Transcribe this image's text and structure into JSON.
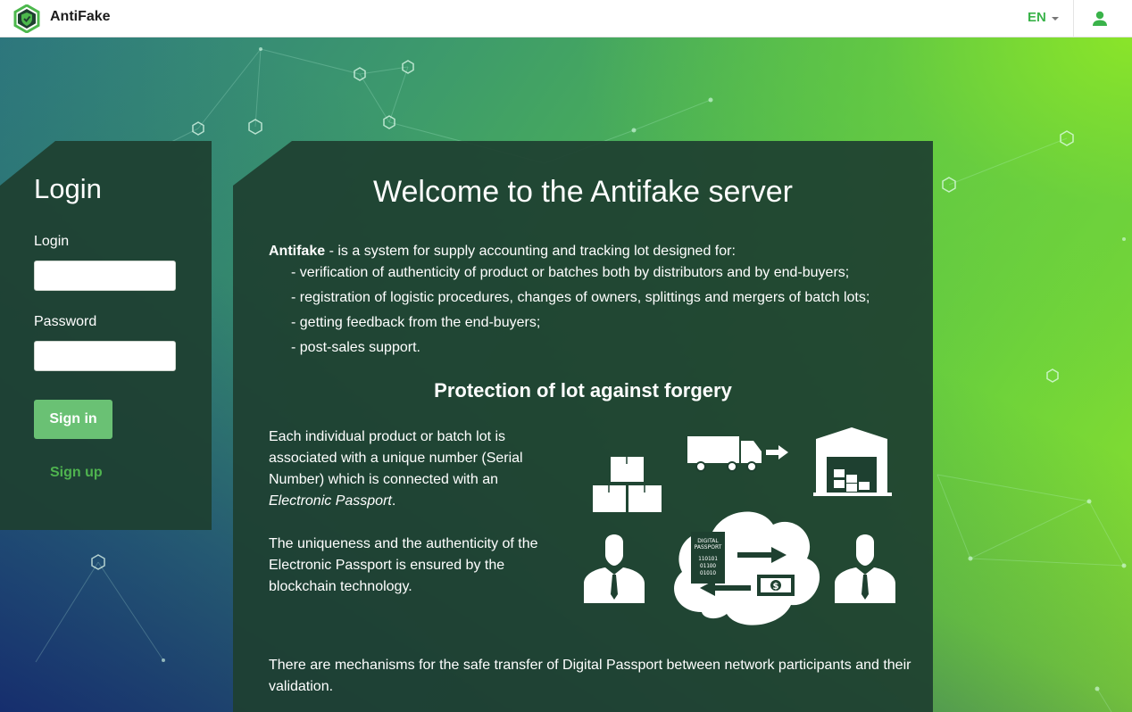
{
  "header": {
    "brand": "AntiFake",
    "language": "EN"
  },
  "login": {
    "title": "Login",
    "login_label": "Login",
    "login_value": "",
    "password_label": "Password",
    "password_value": "",
    "signin_label": "Sign in",
    "signup_label": "Sign up"
  },
  "main": {
    "title": "Welcome to the Antifake server",
    "intro_brand": "Antifake",
    "intro_text": " - is a system for supply accounting and tracking lot designed for:",
    "bullets": [
      "- verification of authenticity of product or batches both by distributors and by end-buyers;",
      "- registration of logistic procedures, changes of owners, splittings and mergers of batch lots;",
      "- getting feedback from the end-buyers;",
      "- post-sales support."
    ],
    "subtitle": "Protection of lot against forgery",
    "para1_text": "Each individual product or batch lot is associated with a unique number (Serial Number) which is connected with an ",
    "para1_italic": "Electronic Passport",
    "para1_end": ".",
    "para2": "The uniqueness and the authenticity of the Electronic Passport is ensured by the blockchain technology.",
    "bottom": "There are mechanisms for the safe transfer of Digital Passport between network participants and their validation.",
    "illustration": {
      "passport_label_1": "DIGITAL",
      "passport_label_2": "PASSPORT",
      "binary_1": "11O1O1",
      "binary_2": "O11OO",
      "binary_3": "O1O1O",
      "money_symbol": "$"
    }
  },
  "colors": {
    "accent": "#3ab34a",
    "panel": "#1e4030",
    "button": "#6ac174"
  },
  "icons": [
    "shield-logo-icon",
    "user-icon",
    "caret-down-icon",
    "box-icon",
    "truck-icon",
    "warehouse-icon",
    "person-icon",
    "cloud-icon",
    "passport-icon",
    "money-icon",
    "arrow-right-icon"
  ]
}
